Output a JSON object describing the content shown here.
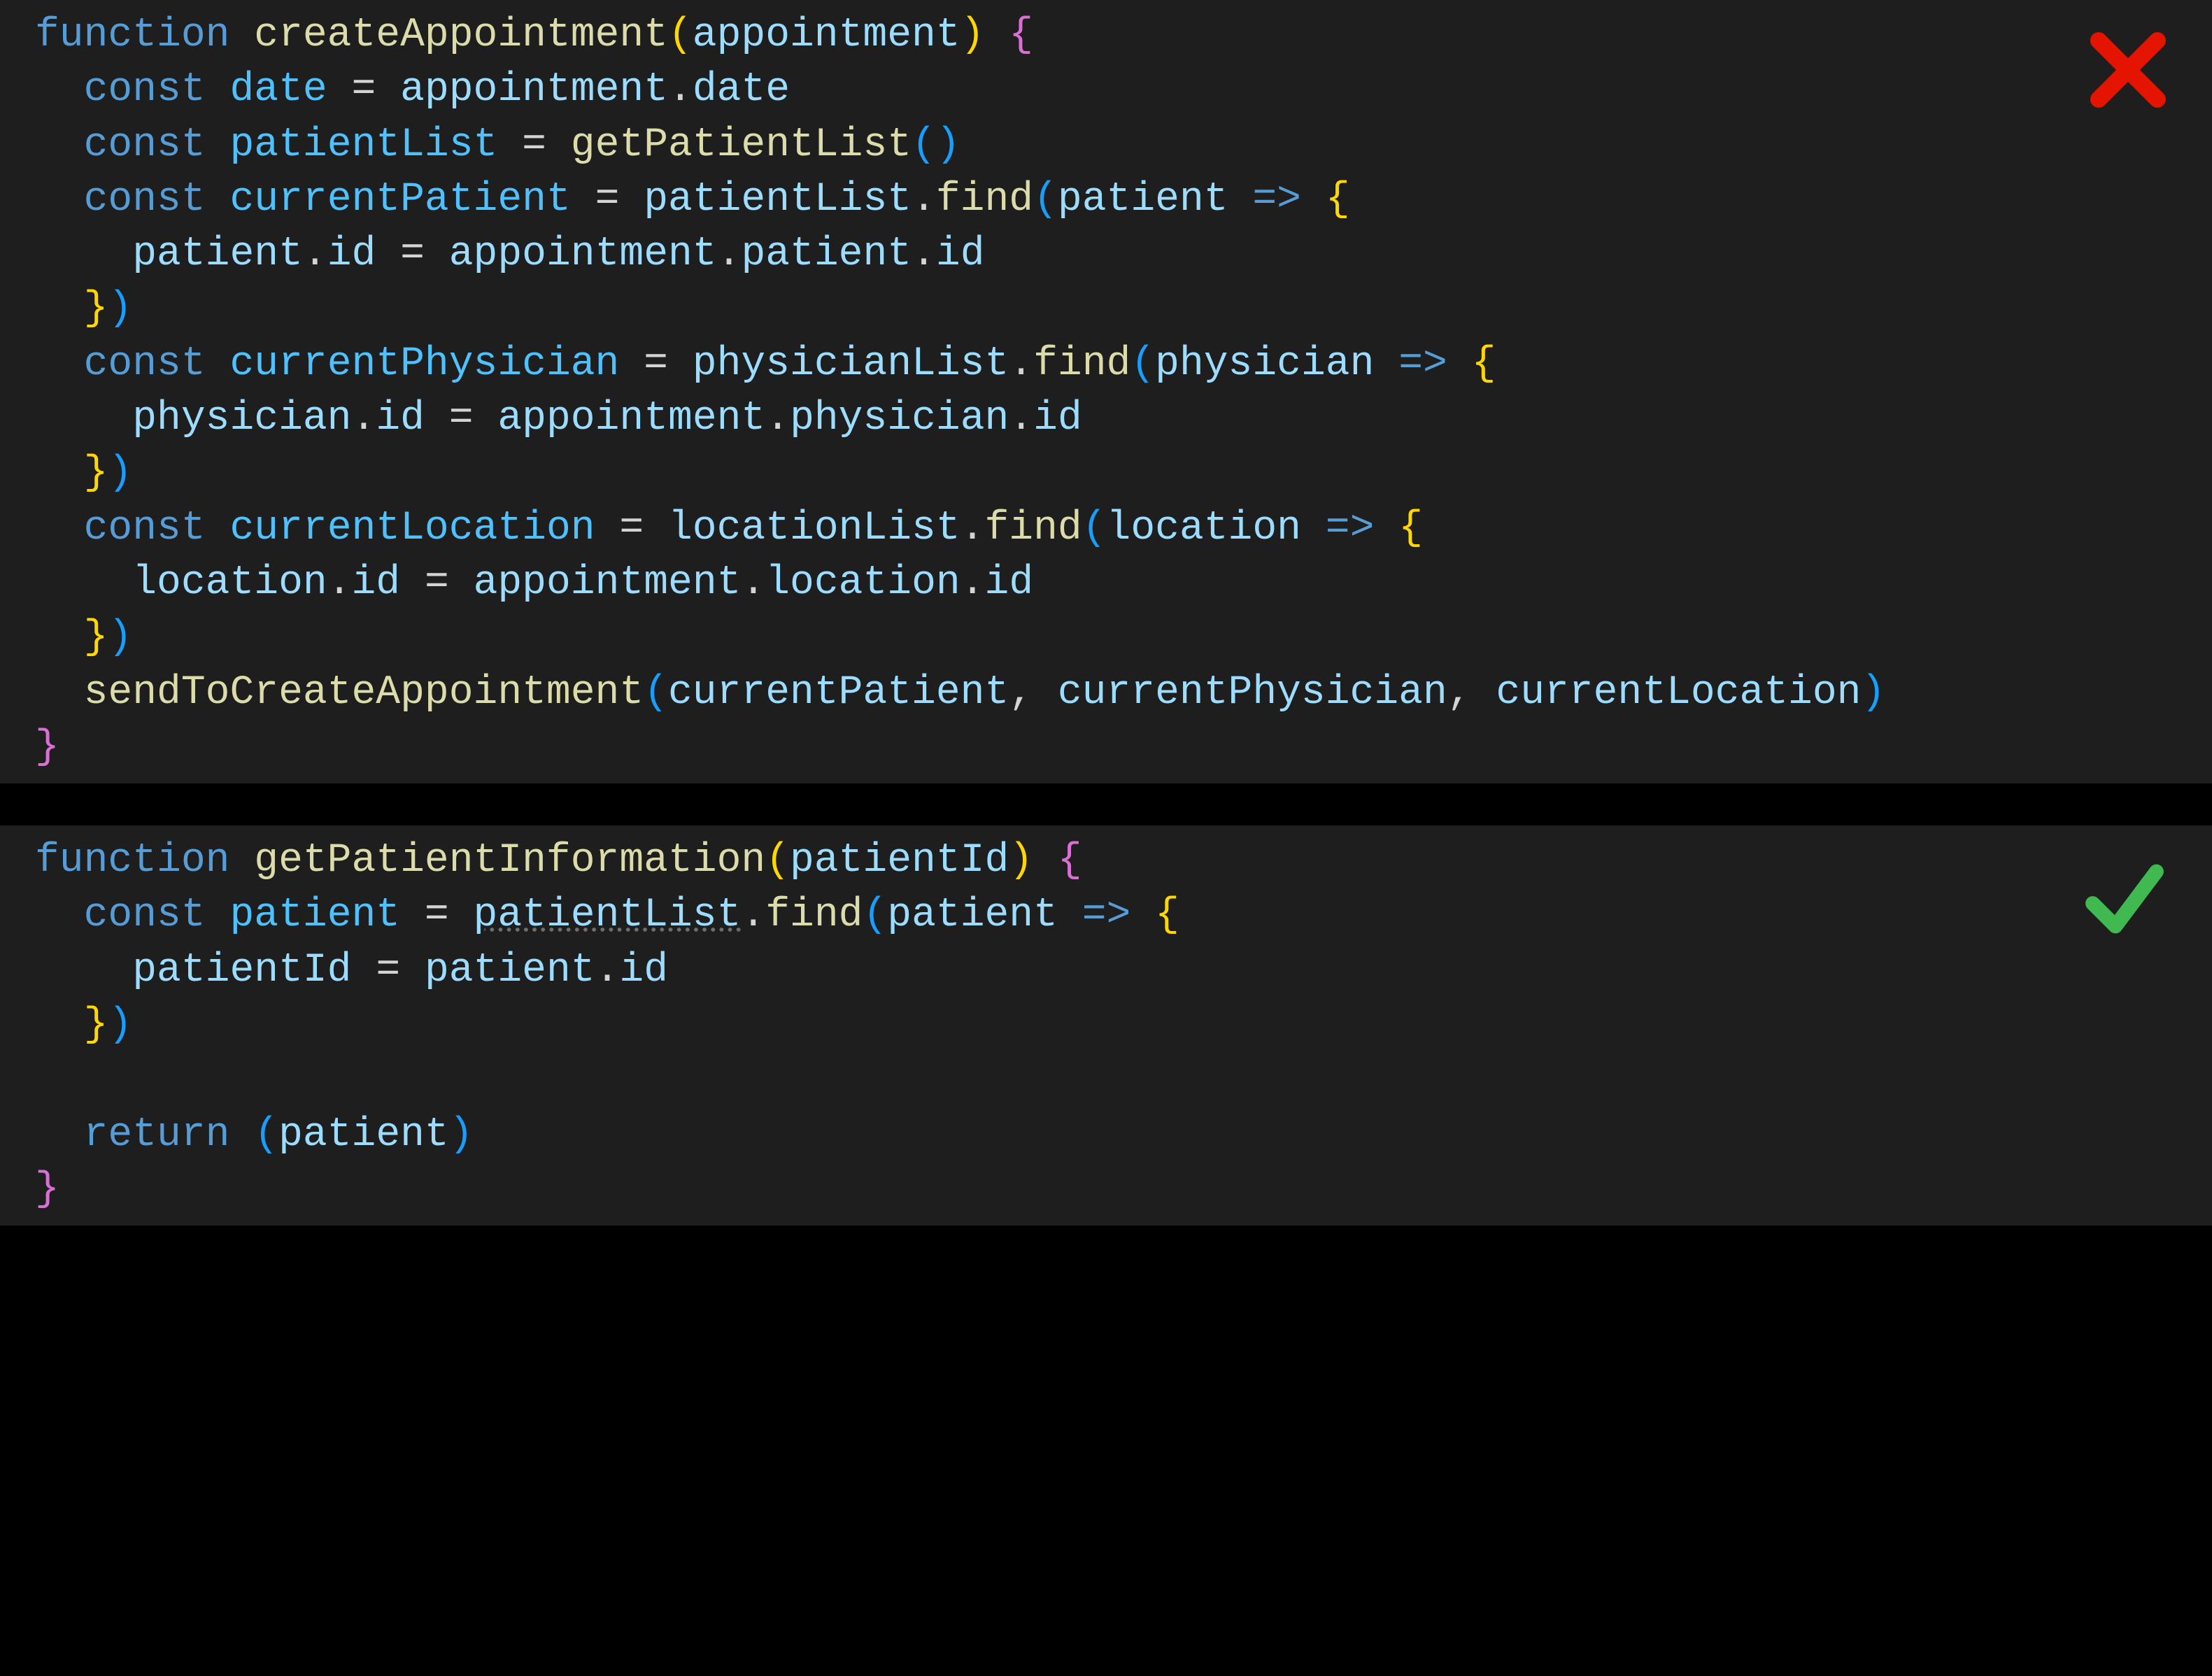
{
  "colors": {
    "background": "#1e1e1e",
    "keyword": "#569cd6",
    "function": "#dcdcaa",
    "variable": "#9cdcfe",
    "constName": "#4fc1ff",
    "braceYellow": "#ffd700",
    "parenMagenta": "#da70d6",
    "parenBlue": "#179fff",
    "crossRed": "#e51400",
    "checkGreen": "#3fb950"
  },
  "top": {
    "status": "bad",
    "lines": {
      "l1_kw_function": "function",
      "l1_fn": "createAppointment",
      "l1_param": "appointment",
      "l2_kw": "const",
      "l2_name": "date",
      "l2_rhs_obj": "appointment",
      "l2_rhs_prop": "date",
      "l3_kw": "const",
      "l3_name": "patientList",
      "l3_fn": "getPatientList",
      "l4_kw": "const",
      "l4_name": "currentPatient",
      "l4_obj": "patientList",
      "l4_fn": "find",
      "l4_param": "patient",
      "l5_lhs_obj": "patient",
      "l5_lhs_prop": "id",
      "l5_rhs_obj": "appointment",
      "l5_rhs_mid": "patient",
      "l5_rhs_prop": "id",
      "l7_kw": "const",
      "l7_name": "currentPhysician",
      "l7_obj": "physicianList",
      "l7_fn": "find",
      "l7_param": "physician",
      "l8_lhs_obj": "physician",
      "l8_lhs_prop": "id",
      "l8_rhs_obj": "appointment",
      "l8_rhs_mid": "physician",
      "l8_rhs_prop": "id",
      "l10_kw": "const",
      "l10_name": "currentLocation",
      "l10_obj": "locationList",
      "l10_fn": "find",
      "l10_param": "location",
      "l11_lhs_obj": "location",
      "l11_lhs_prop": "id",
      "l11_rhs_obj": "appointment",
      "l11_rhs_mid": "location",
      "l11_rhs_prop": "id",
      "l13_fn": "sendToCreateAppointment",
      "l13_arg1": "currentPatient",
      "l13_arg2": "currentPhysician",
      "l13_arg3": "currentLocation"
    }
  },
  "bottom": {
    "status": "good",
    "lines": {
      "l1_kw_function": "function",
      "l1_fn": "getPatientInformation",
      "l1_param": "patientId",
      "l2_kw": "const",
      "l2_name": "patient",
      "l2_obj": "patientList",
      "l2_fn": "find",
      "l2_param": "patient",
      "l3_lhs": "patientId",
      "l3_rhs_obj": "patient",
      "l3_rhs_prop": "id",
      "l5_kw": "return",
      "l5_val": "patient"
    }
  }
}
